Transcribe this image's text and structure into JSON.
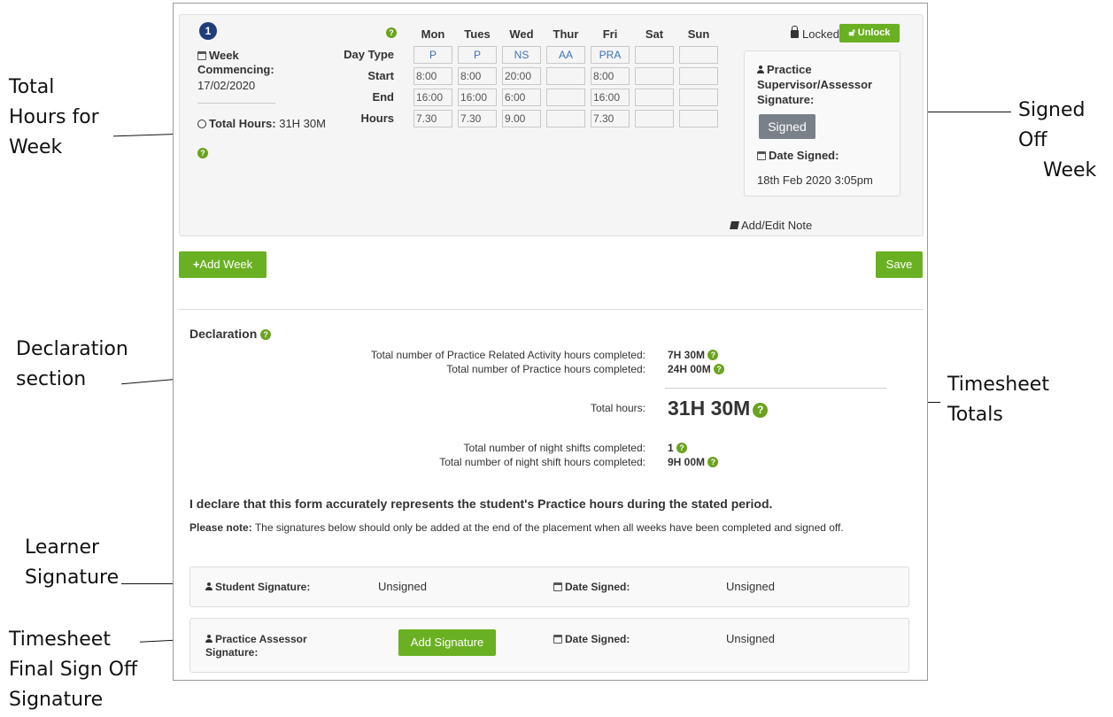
{
  "annotations": {
    "total_hours": [
      "Total",
      "Hours for",
      "Week"
    ],
    "declaration": [
      "Declaration",
      "section"
    ],
    "learner": [
      "Learner",
      "Signature"
    ],
    "timesheet_final": [
      "Timesheet",
      "Final Sign Off",
      "Signature"
    ],
    "signed_off": [
      "Signed Off",
      "Week"
    ],
    "timesheet_totals": [
      "Timesheet",
      "Totals"
    ]
  },
  "week": {
    "number": "1",
    "commencing_label": "Week Commencing:",
    "commencing_date": "17/02/2020",
    "total_label": "Total Hours:",
    "total_value": "31H 30M",
    "days": [
      "Mon",
      "Tues",
      "Wed",
      "Thur",
      "Fri",
      "Sat",
      "Sun"
    ],
    "row_labels": [
      "Day Type",
      "Start",
      "End",
      "Hours"
    ],
    "day_type": [
      "P",
      "P",
      "NS",
      "AA",
      "PRA",
      "",
      ""
    ],
    "start": [
      "8:00",
      "8:00",
      "20:00",
      "",
      "8:00",
      "",
      ""
    ],
    "end": [
      "16:00",
      "16:00",
      "6:00",
      "",
      "16:00",
      "",
      ""
    ],
    "hours": [
      "7.30",
      "7.30",
      "9.00",
      "",
      "7.30",
      "",
      ""
    ],
    "locked_label": "Locked",
    "unlock_label": "Unlock",
    "signoff": {
      "title": "Practice Supervisor/Assessor Signature:",
      "signed_label": "Signed",
      "date_label": "Date Signed:",
      "date_value": "18th Feb 2020 3:05pm"
    },
    "note_label": "Add/Edit Note"
  },
  "actions": {
    "add_week": "Add Week",
    "save": "Save"
  },
  "declaration": {
    "title": "Declaration",
    "pra_label": "Total number of Practice Related Activity hours completed:",
    "pra_value": "7H 30M",
    "practice_label": "Total number of Practice hours completed:",
    "practice_value": "24H 00M",
    "total_label": "Total hours:",
    "total_value": "31H 30M",
    "night_shifts_label": "Total number of night shifts completed:",
    "night_shifts_value": "1",
    "night_hours_label": "Total number of night shift hours completed:",
    "night_hours_value": "9H 00M",
    "statement": "I declare that this form accurately represents the student's Practice hours during the stated period.",
    "note_bold": "Please note:",
    "note_text": " The signatures below should only be added at the end of the placement when all weeks have been completed and signed off."
  },
  "signatures": {
    "student_label": "Student Signature:",
    "student_value": "Unsigned",
    "student_date_label": "Date Signed:",
    "student_date_value": "Unsigned",
    "assessor_label": "Practice Assessor Signature:",
    "assessor_button": "Add Signature",
    "assessor_date_label": "Date Signed:",
    "assessor_date_value": "Unsigned"
  },
  "colors": {
    "green": "#6ab023",
    "navy_badge": "#1f3d7a",
    "signed_grey": "#7a8088"
  }
}
